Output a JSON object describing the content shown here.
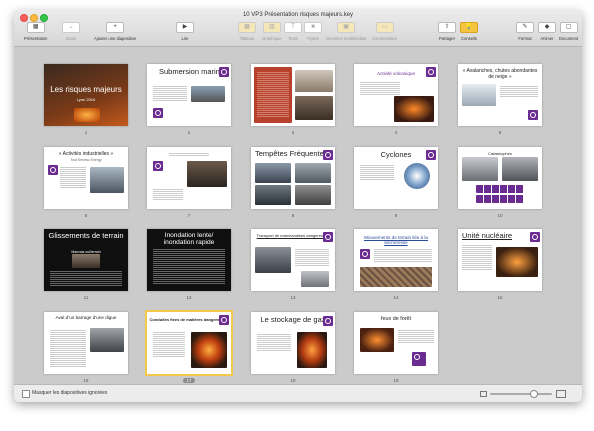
{
  "window": {
    "title": "10 VP3 Présentation risques majeurs.key"
  },
  "toolbar": {
    "presentation": "Présentation",
    "zoom": "Zoom",
    "add_slide": "Ajouter une diapositive",
    "play": "Lire",
    "table": "Tableau",
    "chart": "Graphique",
    "text": "Texte",
    "shape": "Figure",
    "media": "Données multimédias",
    "comment": "Commentaire",
    "share": "Partager",
    "tips": "Conseils",
    "format": "Format",
    "animate": "Animer",
    "document": "Document"
  },
  "slides": [
    {
      "num": "1",
      "title": "Les risques majeurs",
      "subtitle": "Lyon 2016"
    },
    {
      "num": "2",
      "title": "Submersion marine"
    },
    {
      "num": "3",
      "title": ""
    },
    {
      "num": "4",
      "title": "Activité volcanique"
    },
    {
      "num": "5",
      "title": "« Avalanches, chutes abondantes de neige »"
    },
    {
      "num": "6",
      "title": "« Activités industrielles »",
      "subtitle": "Tout Seveso Energy"
    },
    {
      "num": "7",
      "title": ""
    },
    {
      "num": "8",
      "title": "Tempêtes Fréquentes"
    },
    {
      "num": "9",
      "title": "Cyclones"
    },
    {
      "num": "10",
      "title": "Catastrophes"
    },
    {
      "num": "11",
      "title": "Glissements de terrain",
      "subtitle": "Mauvais sol/terrain"
    },
    {
      "num": "12",
      "title": "Inondation lente/ inondation rapide"
    },
    {
      "num": "13",
      "title": "Transport de marchandises dangereuses"
    },
    {
      "num": "14",
      "title": "Mouvements de terrain liés à la sécheresse"
    },
    {
      "num": "15",
      "title": "Unité nucléaire"
    },
    {
      "num": "16",
      "title": "Aval d’un barrage d’une digue"
    },
    {
      "num": "17",
      "title": "Conduites fixes de matières dangereuses"
    },
    {
      "num": "18",
      "title": "Le stockage de gaz"
    },
    {
      "num": "19",
      "title": "feux de forêt"
    }
  ],
  "statusbar": {
    "skip_label": "Masquer les diapositives ignorées"
  },
  "colors": {
    "accent_purple": "#6a2c91",
    "selection": "#f2c94c"
  }
}
